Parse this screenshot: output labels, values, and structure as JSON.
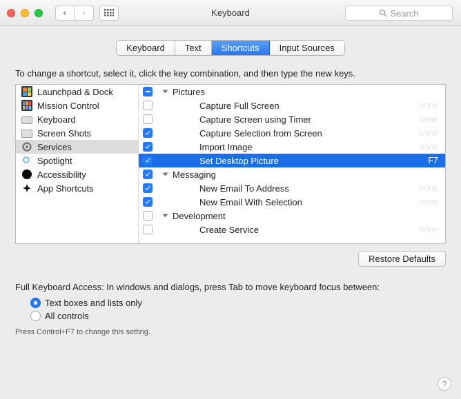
{
  "window": {
    "title": "Keyboard",
    "search_placeholder": "Search"
  },
  "tabs": [
    {
      "label": "Keyboard",
      "active": false
    },
    {
      "label": "Text",
      "active": false
    },
    {
      "label": "Shortcuts",
      "active": true
    },
    {
      "label": "Input Sources",
      "active": false
    }
  ],
  "hint": "To change a shortcut, select it, click the key combination, and then type the new keys.",
  "categories": [
    {
      "label": "Launchpad & Dock",
      "icon": "launchpad",
      "selected": false
    },
    {
      "label": "Mission Control",
      "icon": "mission-control",
      "selected": false
    },
    {
      "label": "Keyboard",
      "icon": "keyboard",
      "selected": false
    },
    {
      "label": "Screen Shots",
      "icon": "screenshot",
      "selected": false
    },
    {
      "label": "Services",
      "icon": "gear",
      "selected": true
    },
    {
      "label": "Spotlight",
      "icon": "spotlight",
      "selected": false
    },
    {
      "label": "Accessibility",
      "icon": "accessibility",
      "selected": false
    },
    {
      "label": "App Shortcuts",
      "icon": "app",
      "selected": false
    }
  ],
  "rows": [
    {
      "type": "group",
      "label": "Pictures",
      "state": "mixed",
      "expanded": true,
      "indent": 0,
      "selected": false
    },
    {
      "type": "item",
      "label": "Capture Full Screen",
      "state": "off",
      "shortcut": "none",
      "indent": 1,
      "selected": false
    },
    {
      "type": "item",
      "label": "Capture Screen using Timer",
      "state": "off",
      "shortcut": "none",
      "indent": 1,
      "selected": false
    },
    {
      "type": "item",
      "label": "Capture Selection from Screen",
      "state": "on",
      "shortcut": "none",
      "indent": 1,
      "selected": false
    },
    {
      "type": "item",
      "label": "Import Image",
      "state": "on",
      "shortcut": "none",
      "indent": 1,
      "selected": false
    },
    {
      "type": "item",
      "label": "Set Desktop Picture",
      "state": "on",
      "shortcut": "F7",
      "indent": 1,
      "selected": true
    },
    {
      "type": "group",
      "label": "Messaging",
      "state": "on",
      "expanded": true,
      "indent": 0,
      "selected": false
    },
    {
      "type": "item",
      "label": "New Email To Address",
      "state": "on",
      "shortcut": "none",
      "indent": 1,
      "selected": false
    },
    {
      "type": "item",
      "label": "New Email With Selection",
      "state": "on",
      "shortcut": "none",
      "indent": 1,
      "selected": false
    },
    {
      "type": "group",
      "label": "Development",
      "state": "off",
      "expanded": true,
      "indent": 0,
      "selected": false
    },
    {
      "type": "item",
      "label": "Create Service",
      "state": "off",
      "shortcut": "none",
      "indent": 1,
      "selected": false
    }
  ],
  "restore_button": "Restore Defaults",
  "fka": {
    "title": "Full Keyboard Access: In windows and dialogs, press Tab to move keyboard focus between:",
    "options": [
      {
        "label": "Text boxes and lists only",
        "selected": true
      },
      {
        "label": "All controls",
        "selected": false
      }
    ],
    "footnote": "Press Control+F7 to change this setting."
  }
}
